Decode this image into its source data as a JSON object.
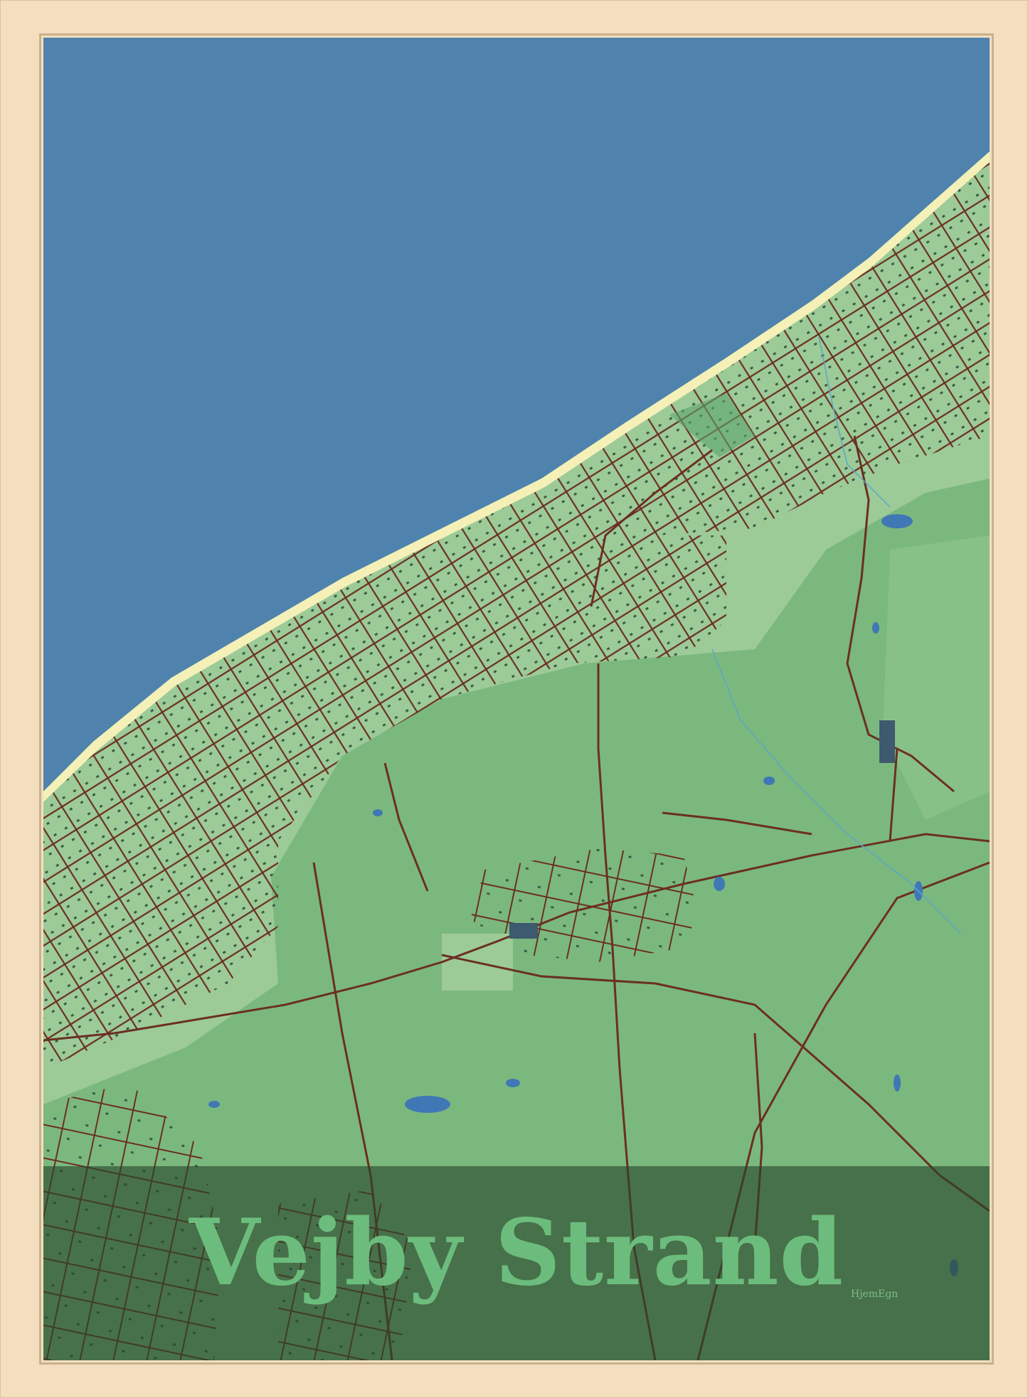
{
  "poster": {
    "title": "Vejby Strand",
    "brand": "HjemEgn"
  },
  "colors": {
    "frame": "#f3dfbf",
    "sea": "#4f83ae",
    "beach": "#f4f0b8",
    "land": "#7bb87e",
    "light_green": "#9ccb98",
    "dark_green": "#5ea56b",
    "roads": "#6b2f22",
    "lakes": "#3f78b5",
    "title_band": "#3a5f3f",
    "title_text": "#6cbd7d"
  }
}
